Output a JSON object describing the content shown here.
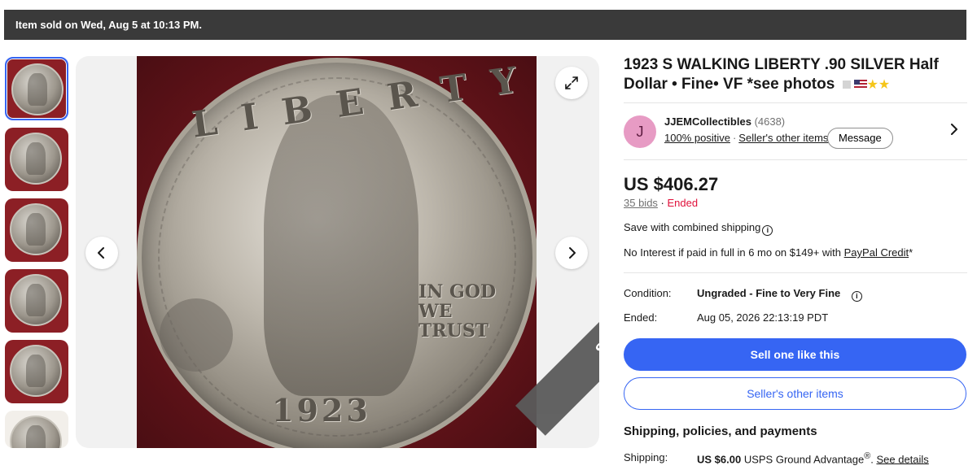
{
  "banner": {
    "text": "Item sold on Wed, Aug 5 at 10:13 PM."
  },
  "gallery": {
    "thumbnail_count": 6,
    "sold_label": "SOLD",
    "coin": {
      "legend": "LIBERTY",
      "motto": "IN GOD WE TRUST",
      "year": "1923"
    },
    "icons": {
      "prev": "chevron-left-icon",
      "next": "chevron-right-icon",
      "expand": "expand-icon"
    }
  },
  "item": {
    "title": "1923 S WALKING LIBERTY .90 SILVER Half Dollar • Fine• VF *see photos",
    "title_icons": [
      "gray-square-icon",
      "us-flag-icon",
      "star-icon",
      "star-icon"
    ]
  },
  "seller": {
    "avatar_letter": "J",
    "name": "JJEMCollectibles",
    "feedback_count": "(4638)",
    "positive": "100% positive",
    "other_items": "Seller's other items",
    "message": "Message"
  },
  "pricing": {
    "price": "US $406.27",
    "bids": "35 bids",
    "separator": " · ",
    "status": "Ended",
    "combined_shipping": "Save with combined shipping",
    "paypal_prefix": "No Interest if paid in full in 6 mo on $149+ with ",
    "paypal_link": "PayPal Credit",
    "paypal_suffix": "*"
  },
  "details": {
    "condition_label": "Condition:",
    "condition_value": "Ungraded - Fine to Very Fine",
    "ended_label": "Ended:",
    "ended_value": "Aug 05, 2026 22:13:19 PDT"
  },
  "actions": {
    "sell_one": "Sell one like this",
    "seller_other_items": "Seller's other items"
  },
  "shipping": {
    "heading": "Shipping, policies, and payments",
    "label": "Shipping:",
    "amount": "US $6.00",
    "service": " USPS Ground Advantage",
    "registered": "®",
    "separator": ". ",
    "details_link": "See details"
  },
  "colors": {
    "accent": "#3665f3",
    "banner": "#3a3a3a",
    "ended": "#e0103a",
    "avatar": "#e79bc4"
  }
}
